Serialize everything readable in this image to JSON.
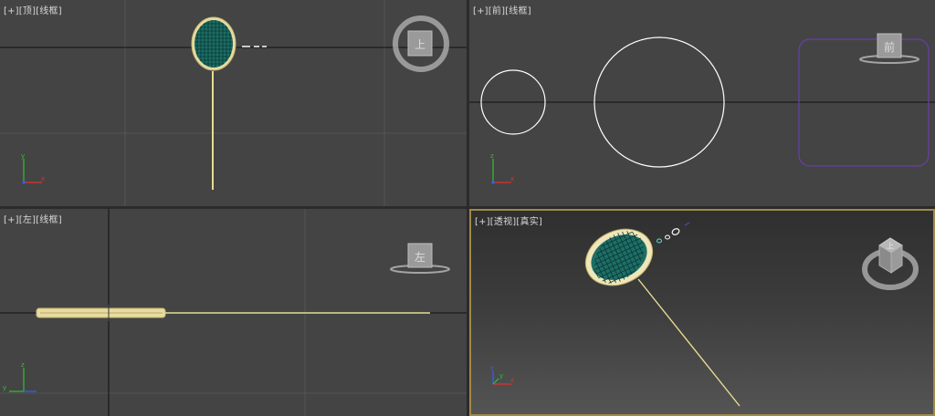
{
  "viewports": {
    "top": {
      "menu": "[+]",
      "view": "[顶]",
      "shading": "[线框]",
      "cube_face": "上"
    },
    "front": {
      "menu": "[+]",
      "view": "[前]",
      "shading": "[线框]",
      "cube_face": "前"
    },
    "left": {
      "menu": "[+]",
      "view": "[左]",
      "shading": "[线框]",
      "cube_face": "左"
    },
    "perspective": {
      "menu": "[+]",
      "view": "[透视]",
      "shading": "[真实]",
      "cube_face": "上"
    }
  },
  "axis_labels": {
    "x": "x",
    "y": "y",
    "z": "z"
  },
  "colors": {
    "viewport_bg": "#444444",
    "grid": "#555555",
    "world_axis": "#111111",
    "selection_wire": "#f2e7a6",
    "racket_mesh": "#1d6e66",
    "racket_string_grid": "#0a3834",
    "front_shape": "#ffffff",
    "front_outline": "#6a3ea8",
    "active_border": "#a08a48",
    "axis_x": "#e03030",
    "axis_y": "#30c030",
    "axis_z": "#3060ff"
  }
}
